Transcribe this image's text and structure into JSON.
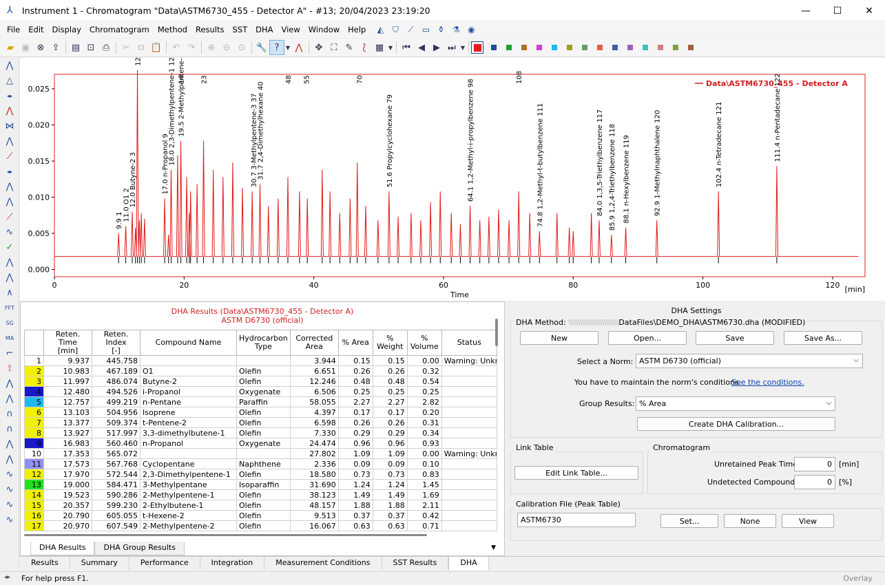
{
  "window": {
    "title": "Instrument 1 - Chromatogram \"Data\\ASTM6730_455 - Detector A\" - #13;   20/04/2023    23:19:20"
  },
  "menu": [
    "File",
    "Edit",
    "Display",
    "Chromatogram",
    "Method",
    "Results",
    "SST",
    "DHA",
    "View",
    "Window",
    "Help"
  ],
  "chart_data": {
    "type": "line",
    "title": "",
    "legend": [
      "Data\\ASTM6730_455 - Detector A"
    ],
    "legend_position": "top-right",
    "xlabel": "Time",
    "xunit": "[min]",
    "ylabel": "",
    "xlim": [
      0,
      125
    ],
    "ylim": [
      -0.001,
      0.027
    ],
    "xticks": [
      0,
      20,
      40,
      60,
      80,
      100,
      120
    ],
    "yticks": [
      "0.000",
      "0.005",
      "0.010",
      "0.015",
      "0.020",
      "0.025"
    ],
    "line_color": "#e01818",
    "baseline": 0.0018,
    "peaks": [
      {
        "x": 9.9,
        "h": 0.0032,
        "label": "9.9 1"
      },
      {
        "x": 11.0,
        "h": 0.0042,
        "label": "11.0 O1 2"
      },
      {
        "x": 12.0,
        "h": 0.0062,
        "label": "12.0 Butyne-2 3"
      },
      {
        "x": 12.5,
        "h": 0.004,
        "label": "12.5 i-Propanol 4"
      },
      {
        "x": 12.8,
        "h": 0.0258,
        "label": "12.8 n-Pentane 5"
      },
      {
        "x": 13.1,
        "h": 0.005,
        "label": "13.1 Isoprene 6"
      },
      {
        "x": 13.4,
        "h": 0.006,
        "label": "13.4 t-Pentene-2 7"
      },
      {
        "x": 13.9,
        "h": 0.0052,
        "label": "13.9 3,3-dimethylbutene-1 8"
      },
      {
        "x": 17.0,
        "h": 0.008,
        "label": "17.0 n-Propanol 9"
      },
      {
        "x": 17.6,
        "h": 0.003,
        "label": "17.6 Cyclopentane 11"
      },
      {
        "x": 18.0,
        "h": 0.012,
        "label": "18.0 2,3-Dimethylpentene-1 12"
      },
      {
        "x": 19.0,
        "h": 0.014,
        "label": "19.0 3-Methylpentane 13"
      },
      {
        "x": 19.5,
        "h": 0.016,
        "label": "19.5 2-Methylpentene-1 14"
      },
      {
        "x": 20.4,
        "h": 0.011,
        "label": "20.4 2-Ethylbutene-1 15"
      },
      {
        "x": 20.8,
        "h": 0.006,
        "label": "20.8 t-Hexene-2 16"
      },
      {
        "x": 21.0,
        "h": 0.009,
        "label": "21.0 2-Methylpentene-2 17"
      },
      {
        "x": 22.0,
        "h": 0.01,
        "label": ""
      },
      {
        "x": 23.0,
        "h": 0.016,
        "label": ""
      },
      {
        "x": 24.5,
        "h": 0.012,
        "label": ""
      },
      {
        "x": 26.0,
        "h": 0.011,
        "label": ""
      },
      {
        "x": 27.5,
        "h": 0.013,
        "label": ""
      },
      {
        "x": 29.0,
        "h": 0.0095,
        "label": ""
      },
      {
        "x": 30.5,
        "h": 0.009,
        "label": ""
      },
      {
        "x": 31.7,
        "h": 0.01,
        "label": ""
      },
      {
        "x": 33.0,
        "h": 0.007,
        "label": ""
      },
      {
        "x": 34.5,
        "h": 0.008,
        "label": ""
      },
      {
        "x": 36.0,
        "h": 0.011,
        "label": ""
      },
      {
        "x": 37.8,
        "h": 0.009,
        "label": ""
      },
      {
        "x": 39.0,
        "h": 0.008,
        "label": ""
      },
      {
        "x": 41.3,
        "h": 0.012,
        "label": ""
      },
      {
        "x": 42.5,
        "h": 0.009,
        "label": ""
      },
      {
        "x": 44.0,
        "h": 0.006,
        "label": ""
      },
      {
        "x": 45.6,
        "h": 0.008,
        "label": ""
      },
      {
        "x": 46.7,
        "h": 0.013,
        "label": ""
      },
      {
        "x": 48.0,
        "h": 0.007,
        "label": ""
      },
      {
        "x": 49.9,
        "h": 0.005,
        "label": ""
      },
      {
        "x": 51.6,
        "h": 0.009,
        "label": ""
      },
      {
        "x": 53.0,
        "h": 0.0055,
        "label": ""
      },
      {
        "x": 55.0,
        "h": 0.006,
        "label": ""
      },
      {
        "x": 56.5,
        "h": 0.005,
        "label": ""
      },
      {
        "x": 58.0,
        "h": 0.0075,
        "label": ""
      },
      {
        "x": 59.5,
        "h": 0.009,
        "label": ""
      },
      {
        "x": 61.2,
        "h": 0.006,
        "label": ""
      },
      {
        "x": 62.6,
        "h": 0.0045,
        "label": ""
      },
      {
        "x": 64.1,
        "h": 0.007,
        "label": ""
      },
      {
        "x": 65.6,
        "h": 0.005,
        "label": ""
      },
      {
        "x": 67.0,
        "h": 0.0055,
        "label": ""
      },
      {
        "x": 68.5,
        "h": 0.0065,
        "label": ""
      },
      {
        "x": 70.1,
        "h": 0.005,
        "label": ""
      },
      {
        "x": 71.6,
        "h": 0.009,
        "label": ""
      },
      {
        "x": 73.3,
        "h": 0.006,
        "label": ""
      },
      {
        "x": 74.8,
        "h": 0.0035,
        "label": ""
      },
      {
        "x": 77.5,
        "h": 0.006,
        "label": ""
      },
      {
        "x": 79.4,
        "h": 0.004,
        "label": ""
      },
      {
        "x": 80.0,
        "h": 0.0035,
        "label": ""
      },
      {
        "x": 82.8,
        "h": 0.006,
        "label": ""
      },
      {
        "x": 84.0,
        "h": 0.005,
        "label": ""
      },
      {
        "x": 85.9,
        "h": 0.003,
        "label": ""
      },
      {
        "x": 88.1,
        "h": 0.004,
        "label": ""
      },
      {
        "x": 92.9,
        "h": 0.005,
        "label": ""
      },
      {
        "x": 102.4,
        "h": 0.009,
        "label": ""
      },
      {
        "x": 111.4,
        "h": 0.0125,
        "label": ""
      }
    ],
    "peak_labels": [
      "9.9 1",
      "11.0 O1 2",
      "12.0 Butyne-2 3",
      "12.8 n-Pentane 5",
      "17.0 n-Propanol 9",
      "18.0 2,3-Dimethylpentene-1 12",
      "19.5 2-Methylpentene-1 14",
      "30.7 3-Methylpentene-3 37",
      "31.7 2,4-Dimethylhexane 40",
      "51.6 Propylcyclohexane 79",
      "64.1 1,2-Methyl-i-propylbenzene 98",
      "74.8 1,2-Methyl-t-butylbenzene 111",
      "84.0 1,3,5-Triethylbenzene 117",
      "85.9 1,2,4-Triethylbenzene 118",
      "88.1 n-Hexylbenzene 119",
      "92.9 1-Methylnaphthalene 120",
      "102.4 n-Tetradecane 121",
      "111.4 n-Pentadecane 122"
    ],
    "top_labels": [
      "14",
      "23",
      "48",
      "55",
      "70",
      "108"
    ]
  },
  "results": {
    "title_line1": "DHA Results (Data\\ASTM6730_455 - Detector A)",
    "title_line2": "ASTM D6730 (official)",
    "headers": [
      "",
      "Reten. Time\n[min]",
      "Reten. Index\n[-]",
      "Compound Name",
      "Hydrocarbon\nType",
      "Corrected\nArea",
      "% Area",
      "%\nWeight",
      "%\nVolume",
      "Status"
    ],
    "rows": [
      {
        "i": "1",
        "c": "#ffffff",
        "rt": "9.937",
        "ri": "445.758",
        "name": "",
        "type": "",
        "area": "3.944",
        "pa": "0.15",
        "pw": "0.15",
        "pv": "0.00",
        "st": "Warning: Unkn"
      },
      {
        "i": "2",
        "c": "#f0f000",
        "rt": "10.983",
        "ri": "467.189",
        "name": "O1",
        "type": "Olefin",
        "area": "6.651",
        "pa": "0.26",
        "pw": "0.26",
        "pv": "0.32",
        "st": ""
      },
      {
        "i": "3",
        "c": "#f0f000",
        "rt": "11.997",
        "ri": "486.074",
        "name": "Butyne-2",
        "type": "Olefin",
        "area": "12.246",
        "pa": "0.48",
        "pw": "0.48",
        "pv": "0.54",
        "st": ""
      },
      {
        "i": "4",
        "c": "#1818c8",
        "rt": "12.480",
        "ri": "494.526",
        "name": "i-Propanol",
        "type": "Oxygenate",
        "area": "6.506",
        "pa": "0.25",
        "pw": "0.25",
        "pv": "0.25",
        "st": ""
      },
      {
        "i": "5",
        "c": "#20b8f0",
        "rt": "12.757",
        "ri": "499.219",
        "name": "n-Pentane",
        "type": "Paraffin",
        "area": "58.055",
        "pa": "2.27",
        "pw": "2.27",
        "pv": "2.82",
        "st": ""
      },
      {
        "i": "6",
        "c": "#f0f000",
        "rt": "13.103",
        "ri": "504.956",
        "name": "Isoprene",
        "type": "Olefin",
        "area": "4.397",
        "pa": "0.17",
        "pw": "0.17",
        "pv": "0.20",
        "st": ""
      },
      {
        "i": "7",
        "c": "#f0f000",
        "rt": "13.377",
        "ri": "509.374",
        "name": "t-Pentene-2",
        "type": "Olefin",
        "area": "6.598",
        "pa": "0.26",
        "pw": "0.26",
        "pv": "0.31",
        "st": ""
      },
      {
        "i": "8",
        "c": "#f0f000",
        "rt": "13.927",
        "ri": "517.997",
        "name": "3,3-dimethylbutene-1",
        "type": "Olefin",
        "area": "7.330",
        "pa": "0.29",
        "pw": "0.29",
        "pv": "0.34",
        "st": ""
      },
      {
        "i": "9",
        "c": "#1818c8",
        "rt": "16.983",
        "ri": "560.460",
        "name": "n-Propanol",
        "type": "Oxygenate",
        "area": "24.474",
        "pa": "0.96",
        "pw": "0.96",
        "pv": "0.93",
        "st": ""
      },
      {
        "i": "10",
        "c": "#ffffff",
        "rt": "17.353",
        "ri": "565.072",
        "name": "",
        "type": "",
        "area": "27.802",
        "pa": "1.09",
        "pw": "1.09",
        "pv": "0.00",
        "st": "Warning: Unkn"
      },
      {
        "i": "11",
        "c": "#9090f0",
        "rt": "17.573",
        "ri": "567.768",
        "name": "Cyclopentane",
        "type": "Naphthene",
        "area": "2.336",
        "pa": "0.09",
        "pw": "0.09",
        "pv": "0.10",
        "st": ""
      },
      {
        "i": "12",
        "c": "#f0f000",
        "rt": "17.970",
        "ri": "572.544",
        "name": "2,3-Dimethylpentene-1",
        "type": "Olefin",
        "area": "18.580",
        "pa": "0.73",
        "pw": "0.73",
        "pv": "0.83",
        "st": ""
      },
      {
        "i": "13",
        "c": "#20e020",
        "rt": "19.000",
        "ri": "584.471",
        "name": "3-Methylpentane",
        "type": "Isoparaffin",
        "area": "31.690",
        "pa": "1.24",
        "pw": "1.24",
        "pv": "1.45",
        "st": ""
      },
      {
        "i": "14",
        "c": "#f0f000",
        "rt": "19.523",
        "ri": "590.286",
        "name": "2-Methylpentene-1",
        "type": "Olefin",
        "area": "38.123",
        "pa": "1.49",
        "pw": "1.49",
        "pv": "1.69",
        "st": ""
      },
      {
        "i": "15",
        "c": "#f0f000",
        "rt": "20.357",
        "ri": "599.230",
        "name": "2-Ethylbutene-1",
        "type": "Olefin",
        "area": "48.157",
        "pa": "1.88",
        "pw": "1.88",
        "pv": "2.11",
        "st": ""
      },
      {
        "i": "16",
        "c": "#f0f000",
        "rt": "20.790",
        "ri": "605.055",
        "name": "t-Hexene-2",
        "type": "Olefin",
        "area": "9.513",
        "pa": "0.37",
        "pw": "0.37",
        "pv": "0.42",
        "st": ""
      },
      {
        "i": "17",
        "c": "#f0f000",
        "rt": "20.970",
        "ri": "607.549",
        "name": "2-Methylpentene-2",
        "type": "Olefin",
        "area": "16.067",
        "pa": "0.63",
        "pw": "0.63",
        "pv": "0.71",
        "st": ""
      }
    ],
    "inner_tabs": [
      "DHA Results",
      "DHA Group Results"
    ]
  },
  "settings": {
    "title": "DHA Settings",
    "method_label": "DHA Method:",
    "method_path_hidden": "\\\\\\\\\\\\\\\\\\\\\\\\\\\\\\\\\\\\\\\\\\\\\\\\\\\\\\",
    "method_path": "DataFiles\\DEMO_DHA\\ASTM6730.dha (MODIFIED)",
    "btn_new": "New",
    "btn_open": "Open...",
    "btn_save": "Save",
    "btn_saveas": "Save As...",
    "norm_label": "Select a Norm:",
    "norm_value": "ASTM D6730 (official)",
    "norm_note": "You have to maintain the norm's conditions.",
    "norm_link": "See the conditions.",
    "group_label": "Group Results:",
    "group_value": "% Area",
    "btn_create_cal": "Create DHA Calibration...",
    "link_table_title": "Link Table",
    "btn_edit_link": "Edit Link Table...",
    "chromatogram_title": "Chromatogram",
    "unretained_label": "Unretained Peak Time:",
    "unretained_value": "0",
    "unretained_unit": "[min]",
    "undetected_label": "Undetected Compounds:",
    "undetected_value": "0",
    "undetected_unit": "[%]",
    "calfile_title": "Calibration File (Peak Table)",
    "calfile_value": "ASTM6730",
    "btn_set": "Set...",
    "btn_none": "None",
    "btn_view": "View"
  },
  "bottom_tabs": [
    "Results",
    "Summary",
    "Performance",
    "Integration",
    "Measurement Conditions",
    "SST Results",
    "DHA"
  ],
  "status": {
    "help": "For help press F1.",
    "overlay": "Overlay"
  }
}
